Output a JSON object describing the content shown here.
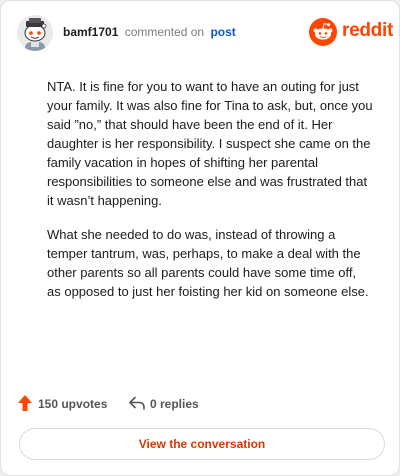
{
  "header": {
    "username": "bamf1701",
    "verb": "commented on",
    "post_link": "post",
    "brand": "reddit"
  },
  "comment": {
    "paragraphs": [
      "NTA. It is fine for you to want to have an outing for just your family. It was also fine for Tina to ask, but, once you said ”no,” that should have been the end of it. Her daughter is her responsibility. I suspect she came on the family vacation in hopes of shifting her parental responsibilities to someone else and was frustrated that it wasn’t happening.",
      "What she needed to do was, instead of throwing a temper tantrum, was, perhaps, to make a deal with the other parents so all parents could have some time off, as opposed to just her foisting her kid on someone else."
    ]
  },
  "actions": {
    "upvotes": "150 upvotes",
    "replies": "0 replies"
  },
  "cta": {
    "label": "View the conversation"
  },
  "colors": {
    "brand": "#ff4500",
    "link": "#0a58c9",
    "cta_text": "#d93a00",
    "upvote": "#ff4500"
  },
  "icons": {
    "avatar": "snoo-avatar",
    "brand": "reddit-logo",
    "upvote": "upvote-arrow-icon",
    "reply": "reply-arrow-icon"
  }
}
